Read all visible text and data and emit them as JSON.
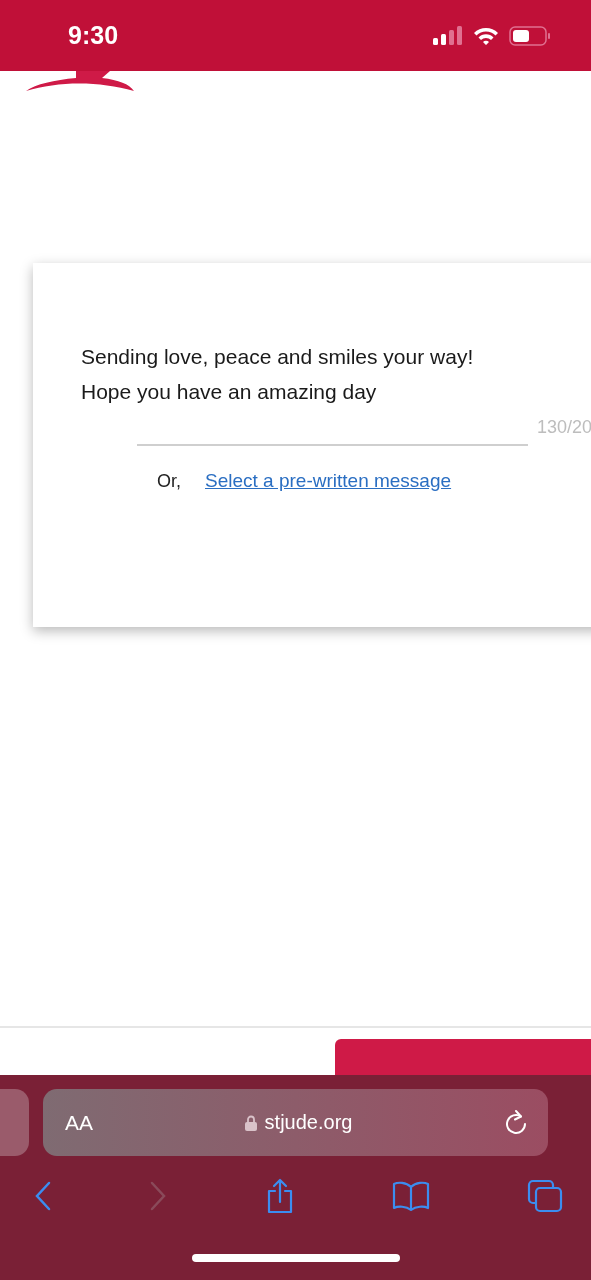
{
  "status_bar": {
    "time": "9:30"
  },
  "message": {
    "value": "Sending love, peace and smiles your way! Hope you have an amazing day",
    "counter": "130/20"
  },
  "alternative": {
    "prefix": "Or,",
    "link": "Select a pre-written message"
  },
  "browser": {
    "text_size": "AA",
    "url": "stjude.org"
  }
}
